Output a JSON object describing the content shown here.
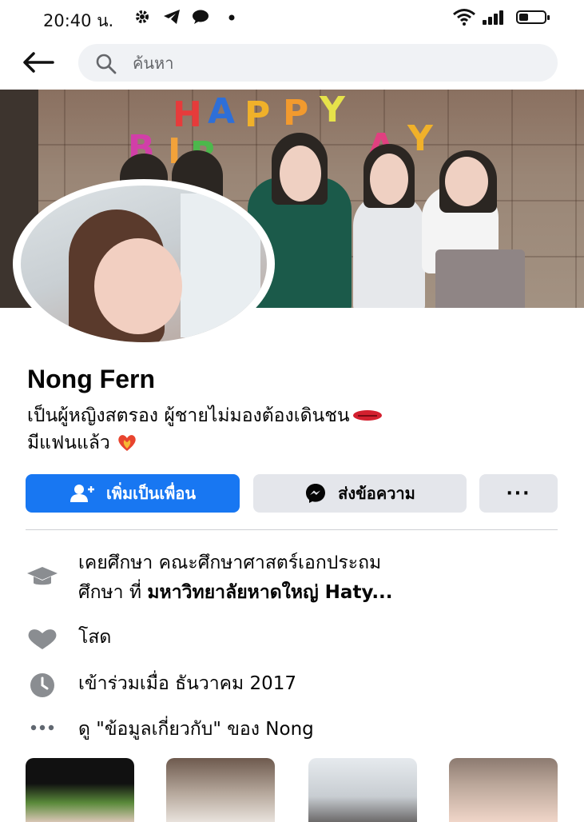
{
  "status_bar": {
    "time": "20:40 น.",
    "icons": [
      "settings-icon",
      "telegram-icon",
      "chat-icon",
      "dot-icon",
      "wifi-icon",
      "signal-icon",
      "battery-icon"
    ],
    "battery_level": 0.35
  },
  "header": {
    "back_icon": "back-arrow-icon",
    "search": {
      "placeholder": "ค้นหา",
      "value": ""
    }
  },
  "cover": {
    "banner_text": "HAPPY BIRTHDAY"
  },
  "profile": {
    "name": "Nong Fern",
    "bio_line1": "เป็นผู้หญิงสตรอง ผู้ชายไม่มองต้องเดินชน",
    "bio_line2": "มีแฟนแล้ว",
    "bio_emojis": [
      "lips-icon",
      "heart-icon"
    ]
  },
  "actions": {
    "add_friend": "เพิ่มเป็นเพื่อน",
    "message": "ส่งข้อความ",
    "more": "···"
  },
  "colors": {
    "primary": "#1877f2",
    "secondary_button": "#e4e6eb",
    "icon_gray": "#8a8d91"
  },
  "details": {
    "education_prefix": "เคยศึกษา คณะศึกษาศาสตร์เอกประถม",
    "education_mid": "ศึกษา ที่ ",
    "education_school": "มหาวิทยาลัยหาดใหญ่ Haty...",
    "relationship": "โสด",
    "joined": "เข้าร่วมเมื่อ ธันวาคม  2017",
    "about": "ดู \"ข้อมูลเกี่ยวกับ\" ของ Nong"
  }
}
